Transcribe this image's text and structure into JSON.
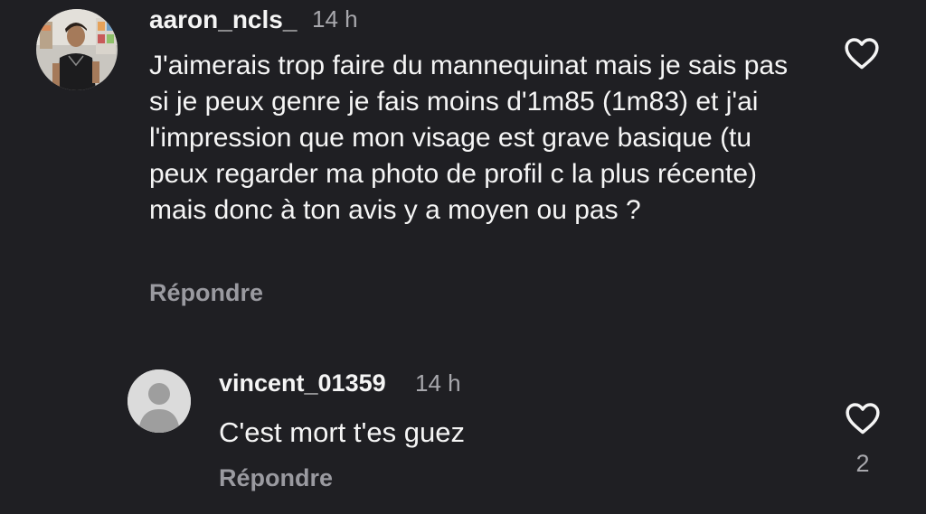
{
  "comments": [
    {
      "username": "aaron_ncls_",
      "time": "14 h",
      "text": "J'aimerais trop faire du mannequinat mais je sais pas si je peux genre je fais moins d'1m85 (1m83) et j'ai l'impression que mon visage est grave basique (tu peux regarder ma photo de profil c la plus récente) mais donc à ton avis y a moyen ou pas ?",
      "reply_label": "Répondre",
      "avatar": "profile-photo",
      "like_icon": "heart-outline-icon"
    },
    {
      "username": "vincent_01359",
      "time": "14 h",
      "text": "C'est mort t'es guez",
      "reply_label": "Répondre",
      "avatar": "default-avatar-icon",
      "like_icon": "heart-outline-icon",
      "like_count": "2"
    }
  ],
  "colors": {
    "background": "#1f1f23",
    "text": "#f5f5f5",
    "muted": "#a8a8ad",
    "reply": "#9a9aa0"
  }
}
